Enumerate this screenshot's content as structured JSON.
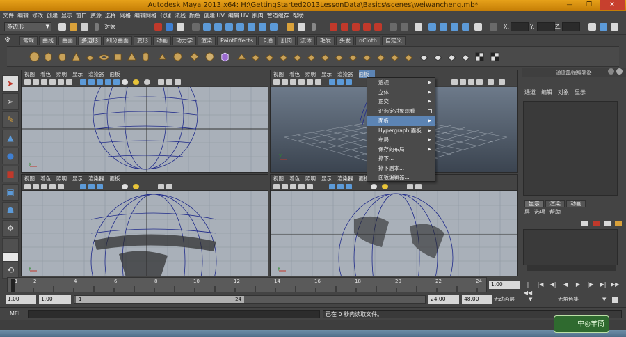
{
  "window": {
    "title": "Autodesk Maya 2013 x64: H:\\GettingStarted2013LessonData\\Basics\\scenes\\weiwancheng.mb*",
    "min": "—",
    "max": "❐",
    "close": "✕"
  },
  "menubar": [
    "文件",
    "编辑",
    "修改",
    "创建",
    "显示",
    "窗口",
    "资源",
    "选择",
    "网格",
    "编辑网格",
    "代理",
    "法线",
    "颜色",
    "创建 UV",
    "编辑 UV",
    "肌肉",
    "管道缓存",
    "帮助"
  ],
  "statusline": {
    "mode": "多边形",
    "object_label": "对象",
    "x_label": "X:",
    "y_label": "Y:",
    "z_label": "Z:"
  },
  "shelf": {
    "tabs": [
      "常规",
      "曲线",
      "曲面",
      "多边形",
      "细分曲面",
      "变形",
      "动画",
      "动力学",
      "渲染",
      "PaintEffects",
      "卡通",
      "肌肉",
      "流体",
      "毛发",
      "头发",
      "nCloth",
      "自定义"
    ],
    "active_tab": 3
  },
  "panels": {
    "menu": [
      "视图",
      "着色",
      "照明",
      "显示",
      "渲染器",
      "面板"
    ]
  },
  "context_menu": {
    "items": [
      {
        "label": "透视",
        "submenu": true
      },
      {
        "label": "立体",
        "submenu": true
      },
      {
        "label": "正交",
        "submenu": true
      },
      {
        "label": "沿选定对象观看",
        "option": true
      },
      {
        "label": "面板",
        "submenu": true,
        "highlighted": true
      },
      {
        "label": "Hypergraph 面板",
        "submenu": true
      },
      {
        "label": "布局",
        "submenu": true
      },
      {
        "label": "保存的布局",
        "submenu": true
      },
      {
        "label": "撕下..."
      },
      {
        "label": "撕下副本..."
      },
      {
        "label": "面板编辑器..."
      }
    ]
  },
  "channel_box": {
    "title": "通道盒/层编辑器",
    "menu": [
      "通道",
      "编辑",
      "对象",
      "显示"
    ],
    "layer_tabs": [
      "显示",
      "渲染",
      "动画"
    ],
    "layer_menu": [
      "层",
      "选项",
      "帮助"
    ]
  },
  "timeline": {
    "ticks": [
      "1",
      "2",
      "4",
      "6",
      "8",
      "10",
      "12",
      "14",
      "16",
      "18",
      "20",
      "22",
      "24"
    ],
    "current_frame": "1.00",
    "playback": [
      "|◀◀",
      "|◀",
      "◀|",
      "◀",
      "▶",
      "|▶",
      "▶|",
      "▶▶|"
    ]
  },
  "range": {
    "start": "1.00",
    "playback_start": "1.00",
    "handle_start": "1",
    "handle_end": "24",
    "playback_end": "24.00",
    "end": "48.00",
    "anim_layer": "无动画层",
    "character_set": "无角色集"
  },
  "command": {
    "label": "MEL",
    "result": "已在 0 秒内读取文件。"
  },
  "watermark": "中◎羊简"
}
